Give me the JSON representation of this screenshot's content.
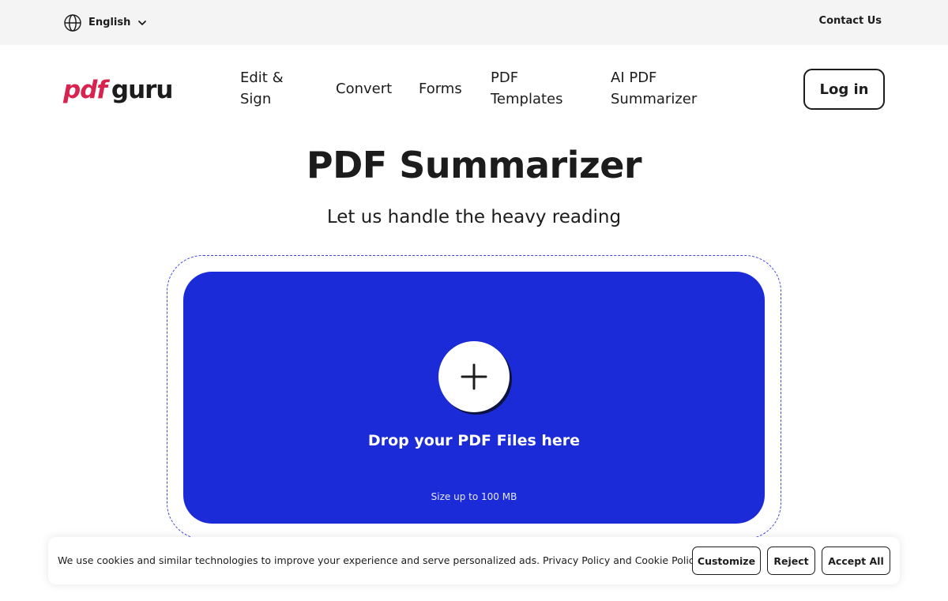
{
  "topbar": {
    "language": "English",
    "language_icon": "globe-icon",
    "contact": "Contact Us"
  },
  "logo": {
    "part_a": "pdf",
    "part_b": "guru"
  },
  "nav": {
    "edit_sign": "Edit & Sign",
    "convert": "Convert",
    "forms": "Forms",
    "templates": "PDF Templates",
    "ai_summarizer": "AI PDF Summarizer",
    "login": "Log in"
  },
  "hero": {
    "title": "PDF Summarizer",
    "subtitle": "Let us handle the heavy reading"
  },
  "upload": {
    "add_icon": "plus-icon",
    "drop_text": "Drop your PDF Files here",
    "size_limit": "Size up to 100 MB"
  },
  "cookie_banner": {
    "message": "We use cookies and similar technologies to improve your experience and serve personalized ads. Privacy Policy and Cookie Policy.",
    "customize": "Customize",
    "reject": "Reject",
    "accept_all": "Accept All"
  },
  "colors": {
    "brand_red": "#d8234e",
    "drop_zone_blue": "#1b2bd8",
    "text_dark": "#1c1c1c"
  }
}
